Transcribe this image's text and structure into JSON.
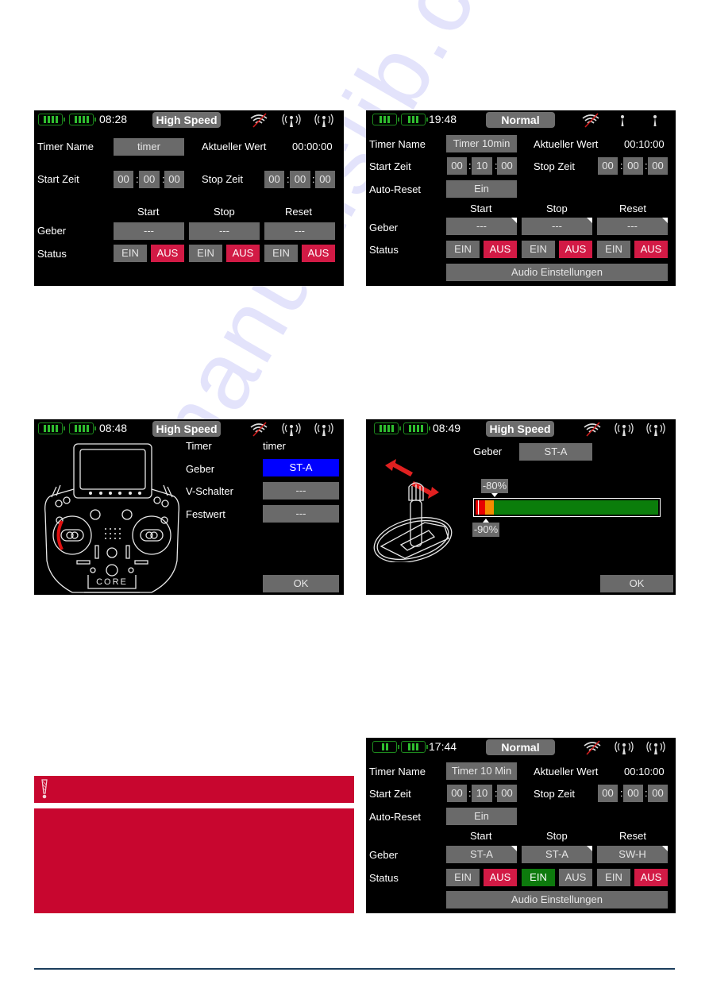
{
  "watermark": "manualslib.com",
  "colors": {
    "screen_bg": "#000000",
    "field_gray": "#6a6a6a",
    "status_red": "#d21a45",
    "status_green": "#0d7a0d",
    "selected_blue": "#0000ff",
    "battery_green": "#2fbf2f",
    "warning_red": "#c8062f",
    "footer_rule": "#1b3d5c"
  },
  "screens": [
    {
      "id": "timer-settings-highspeed",
      "statusbar": {
        "time": "08:28",
        "mode": "High Speed",
        "icons": [
          "battery-icon",
          "battery-icon",
          "wifi-off-icon",
          "antenna-icon",
          "antenna-icon"
        ]
      },
      "timer_name_label": "Timer Name",
      "timer_name_value": "timer",
      "current_value_label": "Aktueller Wert",
      "current_value": "00:00:00",
      "start_time_label": "Start Zeit",
      "start_time": [
        "00",
        "00",
        "00"
      ],
      "stop_time_label": "Stop Zeit",
      "stop_time": [
        "00",
        "00",
        "00"
      ],
      "columns": [
        "Start",
        "Stop",
        "Reset"
      ],
      "geber_label": "Geber",
      "geber": [
        "---",
        "---",
        "---"
      ],
      "status_label": "Status",
      "status": [
        {
          "on": "EIN",
          "off": "AUS",
          "active": "off"
        },
        {
          "on": "EIN",
          "off": "AUS",
          "active": "off"
        },
        {
          "on": "EIN",
          "off": "AUS",
          "active": "off"
        }
      ]
    },
    {
      "id": "timer-settings-normal-empty",
      "statusbar": {
        "time": "19:48",
        "mode": "Normal",
        "icons": [
          "battery-icon",
          "battery-icon",
          "wifi-off-icon",
          "antenna-inactive-icon",
          "antenna-inactive-icon"
        ]
      },
      "timer_name_label": "Timer Name",
      "timer_name_value": "Timer 10min",
      "current_value_label": "Aktueller Wert",
      "current_value": "00:10:00",
      "start_time_label": "Start Zeit",
      "start_time": [
        "00",
        "10",
        "00"
      ],
      "stop_time_label": "Stop Zeit",
      "stop_time": [
        "00",
        "00",
        "00"
      ],
      "auto_reset_label": "Auto-Reset",
      "auto_reset_value": "Ein",
      "columns": [
        "Start",
        "Stop",
        "Reset"
      ],
      "geber_label": "Geber",
      "geber": [
        "---",
        "---",
        "---"
      ],
      "status_label": "Status",
      "status": [
        {
          "on": "EIN",
          "off": "AUS",
          "active": "off"
        },
        {
          "on": "EIN",
          "off": "AUS",
          "active": "off"
        },
        {
          "on": "EIN",
          "off": "AUS",
          "active": "off"
        }
      ],
      "audio_button": "Audio Einstellungen"
    },
    {
      "id": "geber-select",
      "statusbar": {
        "time": "08:48",
        "mode": "High Speed",
        "icons": [
          "battery-icon",
          "battery-icon",
          "wifi-off-icon",
          "antenna-icon",
          "antenna-icon"
        ]
      },
      "image": "transmitter-core-illustration",
      "timer_label": "Timer",
      "timer_value": "timer",
      "geber_label": "Geber",
      "geber_value": "ST-A",
      "v_switch_label": "V-Schalter",
      "v_switch_value": "---",
      "fixed_label": "Festwert",
      "fixed_value": "---",
      "ok_button": "OK"
    },
    {
      "id": "geber-threshold",
      "statusbar": {
        "time": "08:49",
        "mode": "High Speed",
        "icons": [
          "battery-icon",
          "battery-icon",
          "wifi-off-icon",
          "antenna-icon",
          "antenna-icon"
        ]
      },
      "image": "stick-illustration",
      "geber_label": "Geber",
      "geber_value": "ST-A",
      "threshold_upper": "-80%",
      "threshold_lower": "-90%",
      "threshold_upper_pct": -80,
      "threshold_lower_pct": -90,
      "ok_button": "OK"
    },
    {
      "id": "timer-settings-normal-configured",
      "statusbar": {
        "time": "17:44",
        "mode": "Normal",
        "icons": [
          "battery-icon",
          "battery-icon",
          "wifi-off-icon",
          "antenna-icon",
          "antenna-icon"
        ]
      },
      "timer_name_label": "Timer Name",
      "timer_name_value": "Timer 10 Min",
      "current_value_label": "Aktueller Wert",
      "current_value": "00:10:00",
      "start_time_label": "Start Zeit",
      "start_time": [
        "00",
        "10",
        "00"
      ],
      "stop_time_label": "Stop Zeit",
      "stop_time": [
        "00",
        "00",
        "00"
      ],
      "auto_reset_label": "Auto-Reset",
      "auto_reset_value": "Ein",
      "columns": [
        "Start",
        "Stop",
        "Reset"
      ],
      "geber_label": "Geber",
      "geber": [
        "ST-A",
        "ST-A",
        "SW-H"
      ],
      "status_label": "Status",
      "status": [
        {
          "on": "EIN",
          "off": "AUS",
          "active": "off"
        },
        {
          "on": "EIN",
          "off": "AUS",
          "active": "on"
        },
        {
          "on": "EIN",
          "off": "AUS",
          "active": "off"
        }
      ],
      "audio_button": "Audio Einstellungen"
    }
  ],
  "warning": {
    "icon": "exclamation-icon"
  }
}
